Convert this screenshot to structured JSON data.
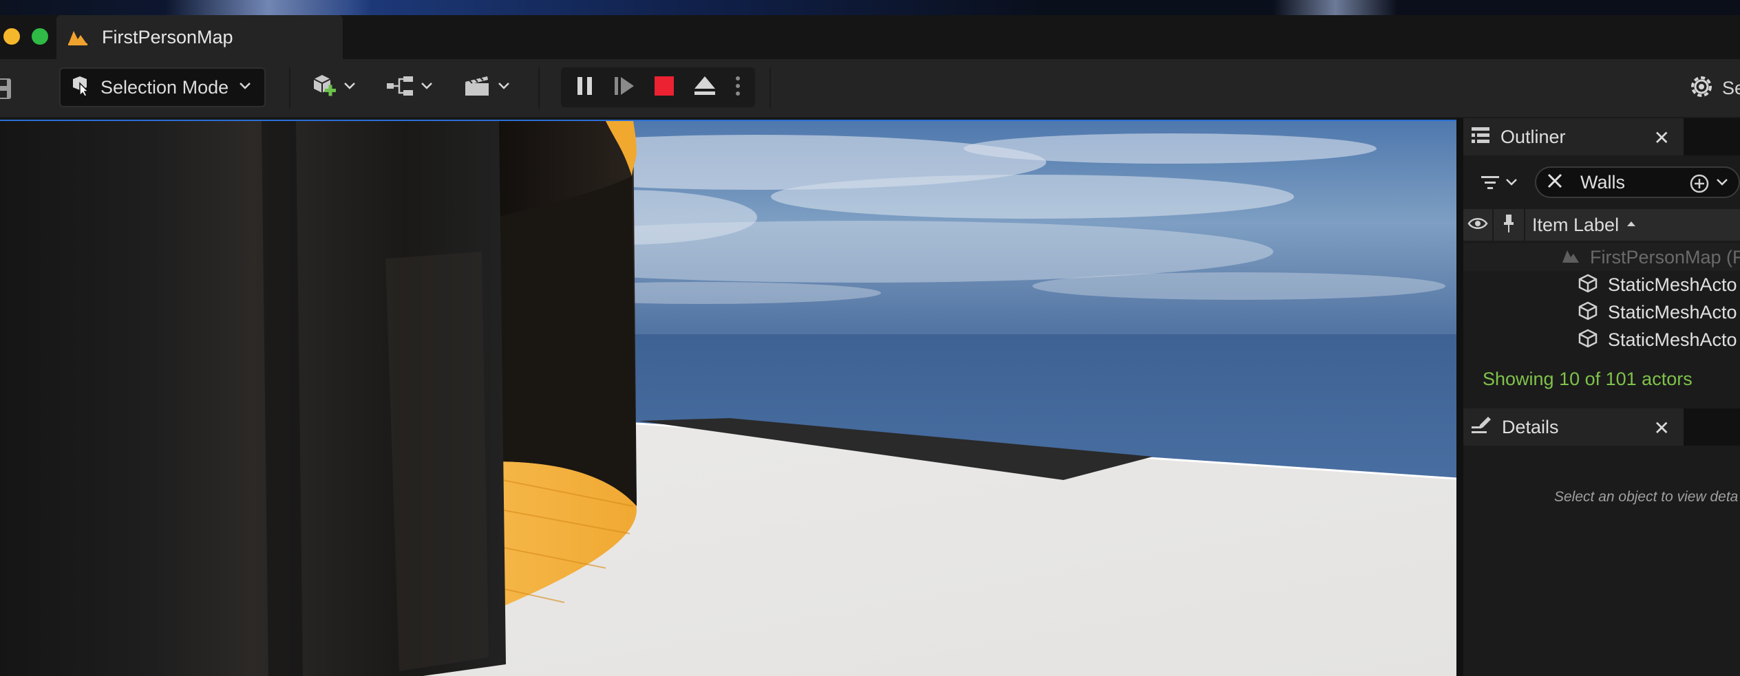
{
  "window": {
    "tab_title": "FirstPersonMap"
  },
  "toolbar": {
    "selection_mode_label": "Selection Mode",
    "settings_label": "Se",
    "stop_color": "#ec2232"
  },
  "outliner": {
    "title": "Outliner",
    "close_glyph": "✕",
    "search_value": "Walls",
    "column_header": "Item Label",
    "root_item": "FirstPersonMap (F",
    "items": [
      "StaticMeshActo",
      "StaticMeshActo",
      "StaticMeshActo"
    ],
    "status": "Showing 10 of 101 actors",
    "status_color": "#7fc24a"
  },
  "details": {
    "title": "Details",
    "close_glyph": "✕",
    "empty_hint": "Select an object to view deta"
  },
  "icons": [
    "save-icon",
    "selection-mode-icon",
    "add-actor-icon",
    "blueprint-icon",
    "cinematics-icon",
    "pause-icon",
    "step-icon",
    "stop-icon",
    "eject-icon",
    "more-icon",
    "settings-icon",
    "outliner-icon",
    "filter-icon",
    "clear-search-icon",
    "add-filter-icon",
    "eye-icon",
    "pin-icon",
    "level-icon",
    "static-mesh-icon",
    "details-icon"
  ]
}
